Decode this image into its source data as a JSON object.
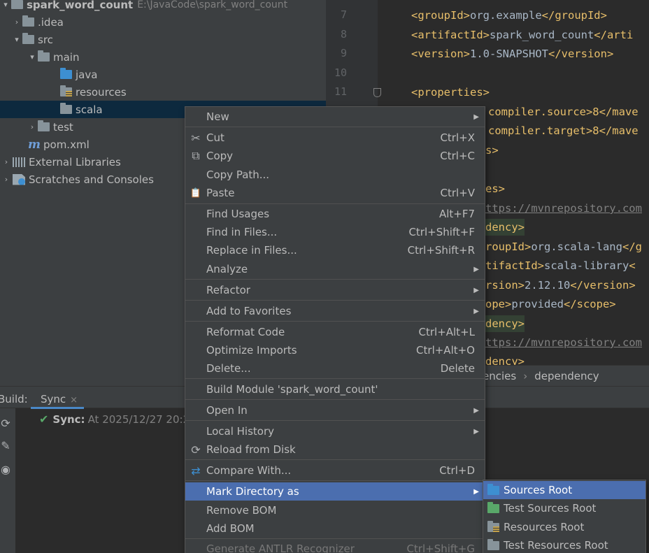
{
  "project_tree": {
    "root": {
      "name": "spark_word_count",
      "path": "E:\\JavaCode\\spark_word_count"
    },
    "idea": ".idea",
    "src": "src",
    "main": "main",
    "java": "java",
    "resources": "resources",
    "scala": "scala",
    "test": "test",
    "pom": "pom.xml",
    "external_libraries": "External Libraries",
    "scratches": "Scratches and Consoles"
  },
  "editor": {
    "line_numbers": [
      "7",
      "8",
      "9",
      "10",
      "11"
    ],
    "lines": [
      {
        "tag_open": "<groupId>",
        "text": "org.example",
        "tag_close": "</groupId>"
      },
      {
        "tag_open": "<artifactId>",
        "text": "spark_word_count",
        "tag_close": "</arti"
      },
      {
        "tag_open": "<version>",
        "text": "1.0-SNAPSHOT",
        "tag_close": "</version>"
      },
      {
        "tag_open": "",
        "text": "",
        "tag_close": ""
      },
      {
        "tag_open": "<properties>",
        "text": "",
        "tag_close": ""
      },
      {
        "tag_open": "",
        "text": "compiler.source>8</mave",
        "tag_close": ""
      },
      {
        "tag_open": "",
        "text": "compiler.target>8</mave",
        "tag_close": ""
      },
      {
        "tag_open": "s>",
        "text": "",
        "tag_close": ""
      },
      {
        "tag_open": "",
        "text": "",
        "tag_close": ""
      },
      {
        "tag_open": "es>",
        "text": "",
        "tag_close": ""
      },
      {
        "url": "ttps://mvnrepository.com"
      },
      {
        "tag_open": "dency>",
        "text": "",
        "tag_close": ""
      },
      {
        "tag_open": "roupId>",
        "text": "org.scala-lang",
        "tag_close": "</g"
      },
      {
        "tag_open": "tifactId>",
        "text": "scala-library",
        "tag_close": "<"
      },
      {
        "tag_open": "rsion>",
        "text": "2.12.10",
        "tag_close": "</version>"
      },
      {
        "tag_open": "ope>",
        "text": "provided",
        "tag_close": "</scope>"
      },
      {
        "tag_open": "dency>",
        "text": "",
        "tag_close": ""
      },
      {
        "url": "ttps://mvnrepository.com"
      },
      {
        "tag_open": "dency>",
        "text": "",
        "tag_close": ""
      }
    ],
    "breadcrumbs": [
      "encies",
      "›",
      "dependency"
    ]
  },
  "build_panel": {
    "label": "Build:",
    "tab": "Sync",
    "tab_close": "×",
    "sync_label": "Sync:",
    "sync_time": "At 2025/12/27 20:2"
  },
  "context_menu": {
    "items": [
      {
        "label": "New",
        "shortcut": "",
        "submenu": true,
        "icon": ""
      },
      {
        "label": "Cut",
        "shortcut": "Ctrl+X",
        "icon": "✂"
      },
      {
        "label": "Copy",
        "shortcut": "Ctrl+C",
        "icon": "⧉"
      },
      {
        "label": "Copy Path...",
        "shortcut": "",
        "icon": ""
      },
      {
        "label": "Paste",
        "shortcut": "Ctrl+V",
        "icon": "📋"
      },
      {
        "label": "Find Usages",
        "shortcut": "Alt+F7"
      },
      {
        "label": "Find in Files...",
        "shortcut": "Ctrl+Shift+F"
      },
      {
        "label": "Replace in Files...",
        "shortcut": "Ctrl+Shift+R"
      },
      {
        "label": "Analyze",
        "shortcut": "",
        "submenu": true
      },
      {
        "label": "Refactor",
        "shortcut": "",
        "submenu": true
      },
      {
        "label": "Add to Favorites",
        "shortcut": "",
        "submenu": true
      },
      {
        "label": "Reformat Code",
        "shortcut": "Ctrl+Alt+L"
      },
      {
        "label": "Optimize Imports",
        "shortcut": "Ctrl+Alt+O"
      },
      {
        "label": "Delete...",
        "shortcut": "Delete"
      },
      {
        "label": "Build Module 'spark_word_count'",
        "shortcut": ""
      },
      {
        "label": "Open In",
        "shortcut": "",
        "submenu": true
      },
      {
        "label": "Local History",
        "shortcut": "",
        "submenu": true
      },
      {
        "label": "Reload from Disk",
        "shortcut": "",
        "icon": "⟳"
      },
      {
        "label": "Compare With...",
        "shortcut": "Ctrl+D",
        "icon": "⇄"
      },
      {
        "label": "Mark Directory as",
        "shortcut": "",
        "submenu": true,
        "active": true
      },
      {
        "label": "Remove BOM",
        "shortcut": ""
      },
      {
        "label": "Add BOM",
        "shortcut": ""
      },
      {
        "label": "Generate ANTLR Recognizer",
        "shortcut": "Ctrl+Shift+G",
        "disabled": true
      }
    ]
  },
  "submenu": {
    "items": [
      {
        "label": "Sources Root",
        "color": "#3d8fd1",
        "active": true
      },
      {
        "label": "Test Sources Root",
        "color": "#59a869"
      },
      {
        "label": "Resources Root",
        "color": "#87939a"
      },
      {
        "label": "Test Resources Root",
        "color": "#87939a"
      }
    ]
  },
  "colors": {
    "selection": "#4b6eaf",
    "tree_selection": "#0d293e",
    "xml_tag": "#e8bf6a"
  }
}
